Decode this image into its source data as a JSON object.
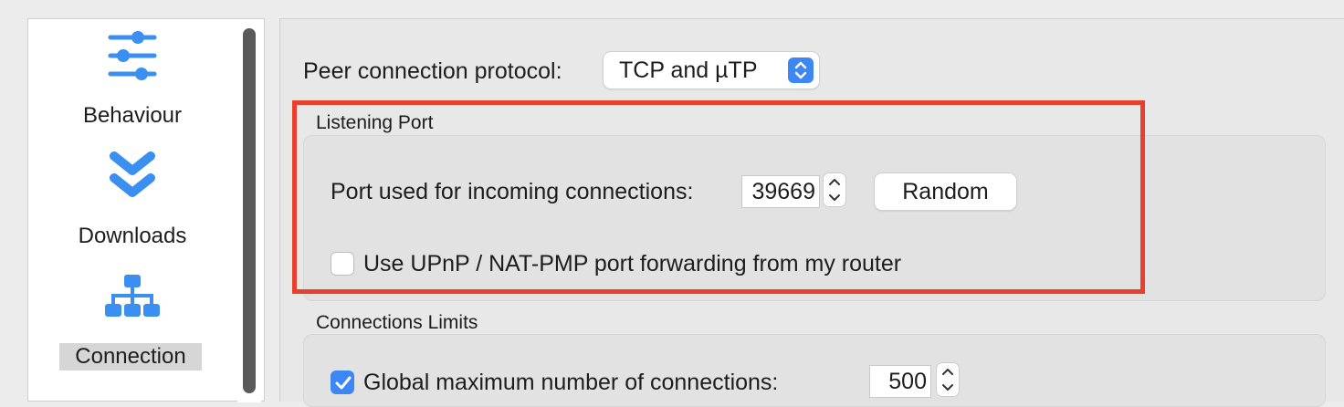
{
  "sidebar": {
    "items": [
      {
        "label": "Behaviour",
        "icon": "sliders-icon"
      },
      {
        "label": "Downloads",
        "icon": "double-chevron-down-icon"
      },
      {
        "label": "Connection",
        "icon": "network-hierarchy-icon",
        "selected": true
      }
    ]
  },
  "connection": {
    "protocol_label": "Peer connection protocol:",
    "protocol_value": "TCP and µTP",
    "listening_port": {
      "title": "Listening Port",
      "port_label": "Port used for incoming connections:",
      "port_value": "39669",
      "random_button": "Random",
      "upnp_label": "Use UPnP / NAT-PMP port forwarding from my router",
      "upnp_checked": false
    },
    "limits": {
      "title": "Connections Limits",
      "global_max_label": "Global maximum number of connections:",
      "global_max_checked": true,
      "global_max_value": "500"
    }
  },
  "colors": {
    "accent": "#3d87f5",
    "icon_blue": "#3a8ff0",
    "highlight_red": "#e8402d"
  }
}
